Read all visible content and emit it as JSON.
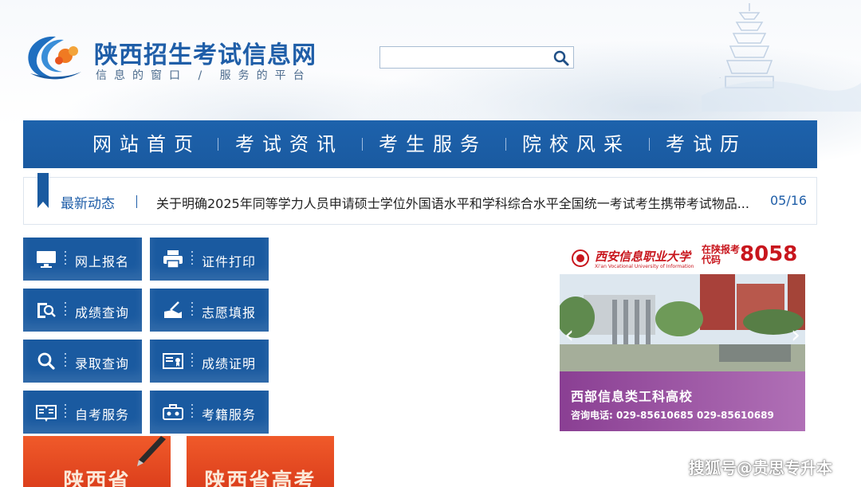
{
  "header": {
    "site_title": "陕西招生考试信息网",
    "slogan": "信息的窗口 / 服务的平台",
    "search_placeholder": ""
  },
  "nav": {
    "items": [
      {
        "label": "网站首页"
      },
      {
        "label": "考试资讯"
      },
      {
        "label": "考生服务"
      },
      {
        "label": "院校风采"
      },
      {
        "label": "考试历"
      }
    ]
  },
  "ticker": {
    "label": "最新动态",
    "headline": "关于明确2025年同等学力人员申请硕士学位外国语水平和学科综合水平全国统一考试考生携带考试物品...",
    "date": "05/16"
  },
  "services": [
    {
      "label": "网上报名",
      "icon": "monitor-icon"
    },
    {
      "label": "证件打印",
      "icon": "printer-icon"
    },
    {
      "label": "成绩查询",
      "icon": "score-search-icon"
    },
    {
      "label": "志愿填报",
      "icon": "write-hand-icon"
    },
    {
      "label": "录取查询",
      "icon": "search-icon"
    },
    {
      "label": "成绩证明",
      "icon": "certificate-icon"
    },
    {
      "label": "自考服务",
      "icon": "book-icon"
    },
    {
      "label": "考籍服务",
      "icon": "briefcase-icon"
    }
  ],
  "ad": {
    "university": "西安信息职业大学",
    "university_en": "Xi'an Vocational University of Information",
    "code_label": "在陕报考代码",
    "code": "8058",
    "slogan": "西部信息类工科高校",
    "phone": "咨询电话: 029-85610685  029-85610689"
  },
  "promos": [
    {
      "text": "陕西省"
    },
    {
      "text": "陕西省高考"
    }
  ],
  "watermark": "搜狐号@贵思专升本",
  "colors": {
    "primary_blue": "#1a5aa0",
    "accent_red": "#c8161d",
    "promo_orange": "#e94a22"
  }
}
